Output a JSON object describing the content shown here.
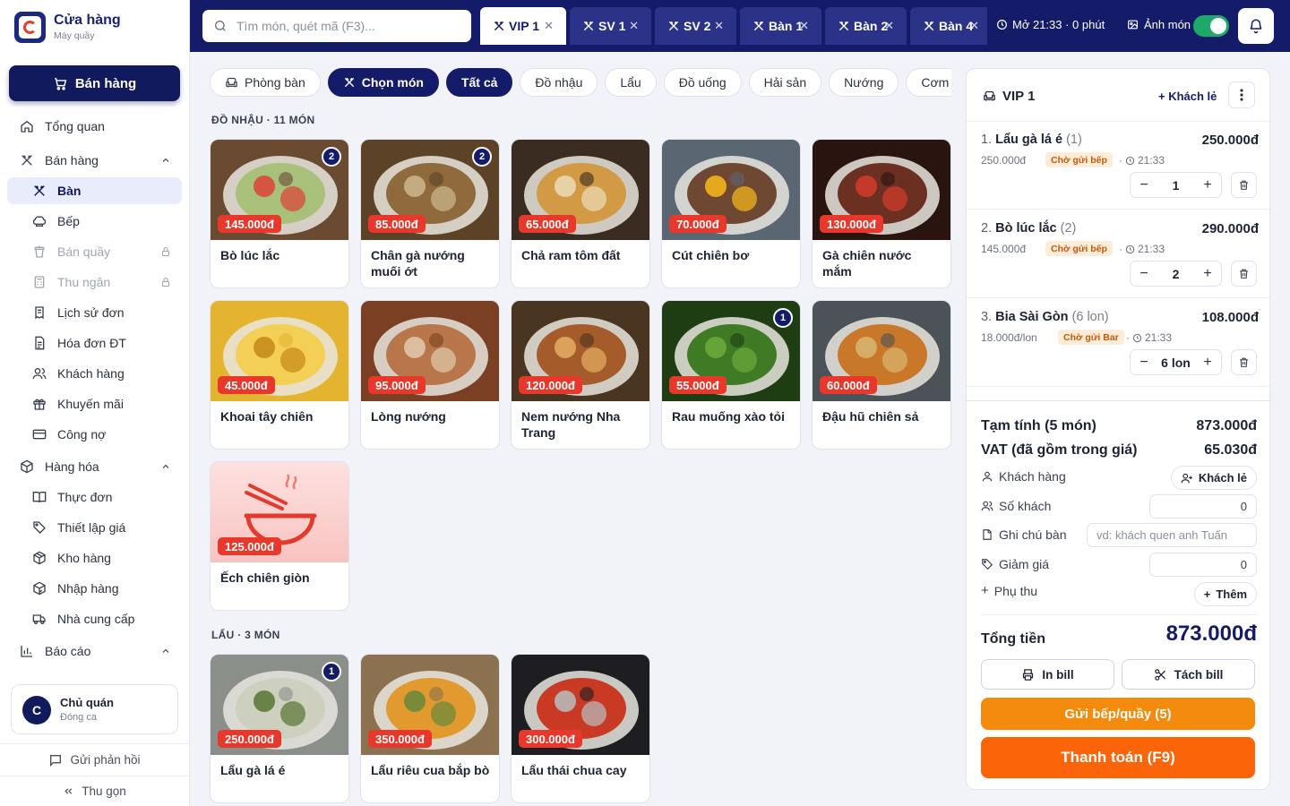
{
  "brand": {
    "name": "Cửa hàng",
    "subtitle": "Máy quầy"
  },
  "sidebar": {
    "primary_button": "Bán hàng",
    "overview": "Tổng quan",
    "groups": [
      {
        "label": "Bán hàng",
        "items": [
          "Bàn",
          "Bếp",
          "Bán quầy",
          "Thu ngân",
          "Lịch sử đơn",
          "Hóa đơn ĐT",
          "Khách hàng",
          "Khuyến mãi",
          "Công nợ"
        ]
      },
      {
        "label": "Hàng hóa",
        "items": [
          "Thực đơn",
          "Thiết lập giá",
          "Kho hàng",
          "Nhập hàng",
          "Nhà cung cấp"
        ]
      },
      {
        "label": "Báo cáo"
      }
    ],
    "active_item": "Bàn",
    "locked_items": [
      "Bán quầy",
      "Thu ngân"
    ],
    "user": {
      "initial": "C",
      "name": "Chủ quán",
      "role": "Đóng ca"
    },
    "feedback": "Gửi phản hồi",
    "collapse": "Thu gọn"
  },
  "topbar": {
    "search_placeholder": "Tìm món, quét mã (F3)...",
    "tabs": [
      "VIP 1",
      "SV 1",
      "SV 2",
      "Bàn 1",
      "Bàn 2",
      "Bàn 4"
    ],
    "active_tab": "VIP 1",
    "status": "Mở 21:33 · 0 phút",
    "photo_toggle_label": "Ảnh món",
    "photo_toggle_on": true
  },
  "chips": [
    "Phòng bàn",
    "Chọn món",
    "Tất cả",
    "Đồ nhậu",
    "Lẩu",
    "Đồ uống",
    "Hải sản",
    "Nướng",
    "Cơm · Mì ·"
  ],
  "sections": [
    {
      "title": "ĐỒ NHẬU · 11 MÓN",
      "items": [
        {
          "name": "Bò lúc lắc",
          "price": "145.000đ",
          "badge": "2",
          "palette": [
            "#6b4a32",
            "#a8c07a",
            "#d84a3a"
          ]
        },
        {
          "name": "Chân gà nướng muối ớt",
          "price": "85.000đ",
          "badge": "2",
          "palette": [
            "#5c4227",
            "#8f6a3c",
            "#c9b48c"
          ]
        },
        {
          "name": "Chả ram tôm đất",
          "price": "65.000đ",
          "badge": "",
          "palette": [
            "#3a2c20",
            "#d39a45",
            "#e9d7b0"
          ]
        },
        {
          "name": "Cút chiên bơ",
          "price": "70.000đ",
          "badge": "",
          "palette": [
            "#5a6672",
            "#6e4833",
            "#f2b21c"
          ]
        },
        {
          "name": "Gà chiên nước mắm",
          "price": "130.000đ",
          "badge": "",
          "palette": [
            "#2a1410",
            "#6c3022",
            "#cf3b2c"
          ]
        },
        {
          "name": "Khoai tây chiên",
          "price": "45.000đ",
          "badge": "",
          "palette": [
            "#e4b431",
            "#f3cf55",
            "#c98c1a"
          ]
        },
        {
          "name": "Lòng nướng",
          "price": "95.000đ",
          "badge": "",
          "palette": [
            "#7b3f24",
            "#b9764a",
            "#dfc7a6"
          ]
        },
        {
          "name": "Nem nướng Nha Trang",
          "price": "120.000đ",
          "badge": "",
          "palette": [
            "#4a3520",
            "#a65c2a",
            "#e2a860"
          ]
        },
        {
          "name": "Rau muống xào tỏi",
          "price": "55.000đ",
          "badge": "1",
          "palette": [
            "#1e3d12",
            "#3f7a24",
            "#6aa83b"
          ]
        },
        {
          "name": "Đậu hũ chiên sả",
          "price": "60.000đ",
          "badge": "",
          "palette": [
            "#4b5258",
            "#c9782a",
            "#d7b36d"
          ]
        },
        {
          "name": "Ếch chiên giòn",
          "price": "125.000đ",
          "badge": "",
          "placeholder": true
        }
      ]
    },
    {
      "title": "LẨU · 3 MÓN",
      "items": [
        {
          "name": "Lẩu gà lá é",
          "price": "250.000đ",
          "badge": "1",
          "palette": [
            "#8a8f8a",
            "#cdd0be",
            "#5e7a3a"
          ]
        },
        {
          "name": "Lẩu riêu cua bắp bò",
          "price": "350.000đ",
          "badge": "",
          "palette": [
            "#8c7150",
            "#e29a2f",
            "#6e8a3a"
          ]
        },
        {
          "name": "Lẩu thái chua cay",
          "price": "300.000đ",
          "badge": "",
          "palette": [
            "#1e1e22",
            "#c93a24",
            "#b8b8b8"
          ]
        }
      ]
    }
  ],
  "order": {
    "table": "VIP 1",
    "guest_link": "Khách lẻ",
    "items": [
      {
        "index": "1.",
        "name": "Lẩu gà lá é",
        "qty_label": "(1)",
        "total": "250.000đ",
        "unit": "250.000đ",
        "status": "Chờ gửi bếp",
        "time": "21:33",
        "qty": "1"
      },
      {
        "index": "2.",
        "name": "Bò lúc lắc",
        "qty_label": "(2)",
        "total": "290.000đ",
        "unit": "145.000đ",
        "status": "Chờ gửi bếp",
        "time": "21:33",
        "qty": "2"
      },
      {
        "index": "3.",
        "name": "Bia Sài Gòn",
        "qty_label": "(6 lon)",
        "total": "108.000đ",
        "unit": "18.000đ/lon",
        "status": "Chờ gửi Bar",
        "time": "21:33",
        "qty": "6 lon"
      }
    ],
    "subtotal_label": "Tạm tính (5 món)",
    "subtotal": "873.000đ",
    "vat_label": "VAT (đã gồm trong giá)",
    "vat": "65.030đ",
    "customer_label": "Khách hàng",
    "customer_button": "Khách lẻ",
    "guests_label": "Số khách",
    "guests": "0",
    "note_label": "Ghi chú bàn",
    "note_placeholder": "vd: khách quen anh Tuấn",
    "discount_label": "Giảm giá",
    "discount": "0",
    "surcharge_label": "Phụ thu",
    "surcharge_button": "Thêm",
    "total_label": "Tổng tiền",
    "total": "873.000đ",
    "print": "In bill",
    "split": "Tách bill",
    "send": "Gửi bếp/quầy (5)",
    "pay": "Thanh toán (F9)"
  },
  "colors": {
    "navy": "#141c6a",
    "price_tag": "#e8382b",
    "send": "#f58b0c",
    "pay": "#fb6409",
    "status_bg": "#fdecd8",
    "status_fg": "#c4590c",
    "toggle_on": "#1fa968"
  }
}
